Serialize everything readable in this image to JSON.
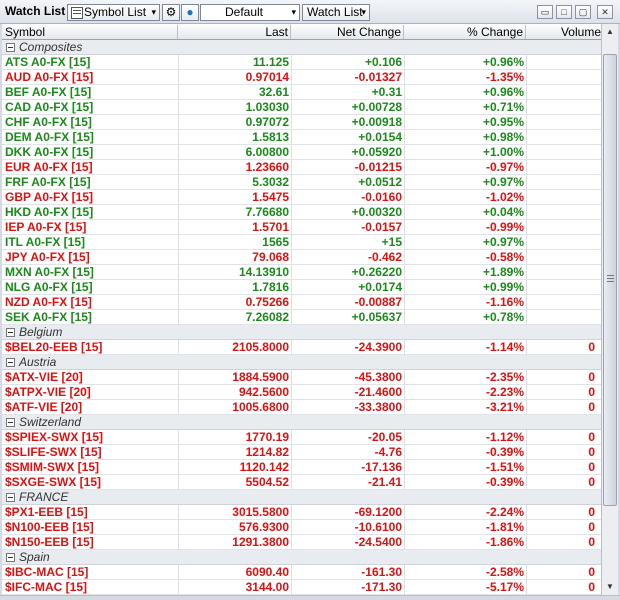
{
  "toolbar": {
    "title": "Watch List",
    "symbol_list_label": "Symbol List",
    "gear_icon": "⚙",
    "tweet_icon": "●",
    "layout_value": "Default",
    "watchlist_label": "Watch List",
    "dropdown_arrow": "▾",
    "window_controls": [
      "▭",
      "□",
      "▢",
      "✕"
    ]
  },
  "columns": {
    "symbol": "Symbol",
    "last": "Last",
    "net_change": "Net Change",
    "pct_change": "% Change",
    "volume": "Volume"
  },
  "colors": {
    "up": "#1a8a1a",
    "down": "#e01010"
  },
  "groups": [
    {
      "name": "Composites",
      "rows": [
        {
          "symbol": "ATS A0-FX [15]",
          "last": "11.125",
          "chg": "+0.106",
          "pct": "+0.96%",
          "vol": "",
          "dir": "up"
        },
        {
          "symbol": "AUD A0-FX [15]",
          "last": "0.97014",
          "chg": "-0.01327",
          "pct": "-1.35%",
          "vol": "",
          "dir": "down"
        },
        {
          "symbol": "BEF A0-FX [15]",
          "last": "32.61",
          "chg": "+0.31",
          "pct": "+0.96%",
          "vol": "",
          "dir": "up"
        },
        {
          "symbol": "CAD A0-FX [15]",
          "last": "1.03030",
          "chg": "+0.00728",
          "pct": "+0.71%",
          "vol": "",
          "dir": "up"
        },
        {
          "symbol": "CHF A0-FX [15]",
          "last": "0.97072",
          "chg": "+0.00918",
          "pct": "+0.95%",
          "vol": "",
          "dir": "up"
        },
        {
          "symbol": "DEM A0-FX [15]",
          "last": "1.5813",
          "chg": "+0.0154",
          "pct": "+0.98%",
          "vol": "",
          "dir": "up"
        },
        {
          "symbol": "DKK A0-FX [15]",
          "last": "6.00800",
          "chg": "+0.05920",
          "pct": "+1.00%",
          "vol": "",
          "dir": "up"
        },
        {
          "symbol": "EUR A0-FX [15]",
          "last": "1.23660",
          "chg": "-0.01215",
          "pct": "-0.97%",
          "vol": "",
          "dir": "down"
        },
        {
          "symbol": "FRF A0-FX [15]",
          "last": "5.3032",
          "chg": "+0.0512",
          "pct": "+0.97%",
          "vol": "",
          "dir": "up"
        },
        {
          "symbol": "GBP A0-FX [15]",
          "last": "1.5475",
          "chg": "-0.0160",
          "pct": "-1.02%",
          "vol": "",
          "dir": "down"
        },
        {
          "symbol": "HKD A0-FX [15]",
          "last": "7.76680",
          "chg": "+0.00320",
          "pct": "+0.04%",
          "vol": "",
          "dir": "up"
        },
        {
          "symbol": "IEP A0-FX [15]",
          "last": "1.5701",
          "chg": "-0.0157",
          "pct": "-0.99%",
          "vol": "",
          "dir": "down"
        },
        {
          "symbol": "ITL A0-FX [15]",
          "last": "1565",
          "chg": "+15",
          "pct": "+0.97%",
          "vol": "",
          "dir": "up"
        },
        {
          "symbol": "JPY A0-FX [15]",
          "last": "79.068",
          "chg": "-0.462",
          "pct": "-0.58%",
          "vol": "",
          "dir": "down"
        },
        {
          "symbol": "MXN A0-FX [15]",
          "last": "14.13910",
          "chg": "+0.26220",
          "pct": "+1.89%",
          "vol": "",
          "dir": "up"
        },
        {
          "symbol": "NLG A0-FX [15]",
          "last": "1.7816",
          "chg": "+0.0174",
          "pct": "+0.99%",
          "vol": "",
          "dir": "up"
        },
        {
          "symbol": "NZD A0-FX [15]",
          "last": "0.75266",
          "chg": "-0.00887",
          "pct": "-1.16%",
          "vol": "",
          "dir": "down"
        },
        {
          "symbol": "SEK A0-FX [15]",
          "last": "7.26082",
          "chg": "+0.05637",
          "pct": "+0.78%",
          "vol": "",
          "dir": "up"
        }
      ]
    },
    {
      "name": "Belgium",
      "rows": [
        {
          "symbol": "$BEL20-EEB [15]",
          "last": "2105.8000",
          "chg": "-24.3900",
          "pct": "-1.14%",
          "vol": "0",
          "dir": "down"
        }
      ]
    },
    {
      "name": "Austria",
      "rows": [
        {
          "symbol": "$ATX-VIE [20]",
          "last": "1884.5900",
          "chg": "-45.3800",
          "pct": "-2.35%",
          "vol": "0",
          "dir": "down"
        },
        {
          "symbol": "$ATPX-VIE [20]",
          "last": "942.5600",
          "chg": "-21.4600",
          "pct": "-2.23%",
          "vol": "0",
          "dir": "down"
        },
        {
          "symbol": "$ATF-VIE [20]",
          "last": "1005.6800",
          "chg": "-33.3800",
          "pct": "-3.21%",
          "vol": "0",
          "dir": "down"
        }
      ]
    },
    {
      "name": "Switzerland",
      "rows": [
        {
          "symbol": "$SPIEX-SWX [15]",
          "last": "1770.19",
          "chg": "-20.05",
          "pct": "-1.12%",
          "vol": "0",
          "dir": "down"
        },
        {
          "symbol": "$SLIFE-SWX [15]",
          "last": "1214.82",
          "chg": "-4.76",
          "pct": "-0.39%",
          "vol": "0",
          "dir": "down"
        },
        {
          "symbol": "$SMIM-SWX [15]",
          "last": "1120.142",
          "chg": "-17.136",
          "pct": "-1.51%",
          "vol": "0",
          "dir": "down"
        },
        {
          "symbol": "$SXGE-SWX [15]",
          "last": "5504.52",
          "chg": "-21.41",
          "pct": "-0.39%",
          "vol": "0",
          "dir": "down"
        }
      ]
    },
    {
      "name": "FRANCE",
      "rows": [
        {
          "symbol": "$PX1-EEB [15]",
          "last": "3015.5800",
          "chg": "-69.1200",
          "pct": "-2.24%",
          "vol": "0",
          "dir": "down"
        },
        {
          "symbol": "$N100-EEB [15]",
          "last": "576.9300",
          "chg": "-10.6100",
          "pct": "-1.81%",
          "vol": "0",
          "dir": "down"
        },
        {
          "symbol": "$N150-EEB [15]",
          "last": "1291.3800",
          "chg": "-24.5400",
          "pct": "-1.86%",
          "vol": "0",
          "dir": "down"
        }
      ]
    },
    {
      "name": "Spain",
      "rows": [
        {
          "symbol": "$IBC-MAC [15]",
          "last": "6090.40",
          "chg": "-161.30",
          "pct": "-2.58%",
          "vol": "0",
          "dir": "down"
        },
        {
          "symbol": "$IFC-MAC [15]",
          "last": "3144.00",
          "chg": "-171.30",
          "pct": "-5.17%",
          "vol": "0",
          "dir": "down"
        }
      ]
    }
  ]
}
